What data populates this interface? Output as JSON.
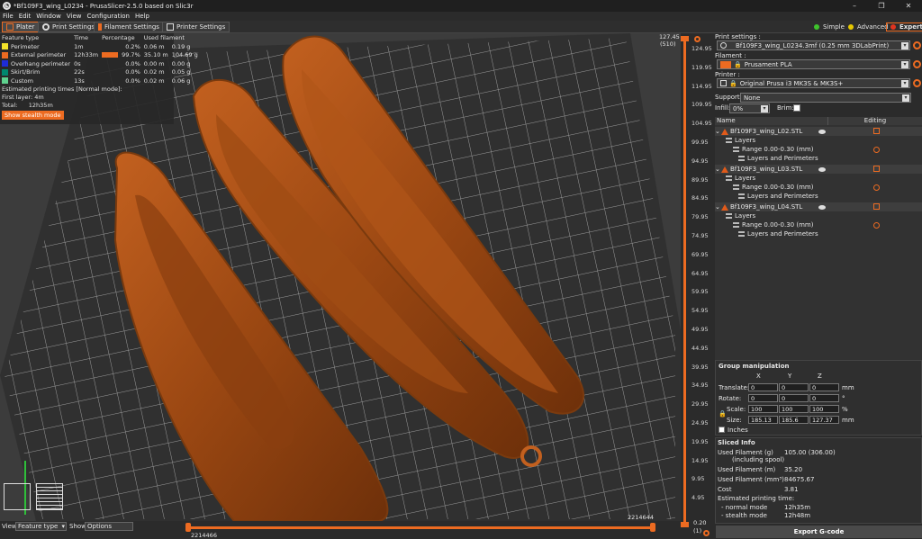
{
  "window": {
    "title": "*Bf109F3_wing_L0234 - PrusaSlicer-2.5.0 based on Slic3r",
    "controls": [
      "–",
      "❐",
      "✕"
    ]
  },
  "menu": [
    "File",
    "Edit",
    "Window",
    "View",
    "Configuration",
    "Help"
  ],
  "tabs": [
    "Plater",
    "Print Settings",
    "Filament Settings",
    "Printer Settings"
  ],
  "modes": [
    {
      "label": "Simple",
      "color": "#3ec32c"
    },
    {
      "label": "Advanced",
      "color": "#e6c800"
    },
    {
      "label": "Expert",
      "color": "#e0341f"
    }
  ],
  "legend": {
    "headers": [
      "Feature type",
      "Time",
      "Percentage",
      "Used filament"
    ],
    "rows": [
      {
        "name": "Perimeter",
        "color": "#f2e22a",
        "time": "1m",
        "pct": "0.2%",
        "pct_value": 0.2,
        "len": "0.06 m",
        "weight": "0.19 g"
      },
      {
        "name": "External perimeter",
        "color": "#ed6b21",
        "time": "12h33m",
        "pct": "99.7%",
        "pct_value": 99.7,
        "len": "35.10 m",
        "weight": "104.69 g"
      },
      {
        "name": "Overhang perimeter",
        "color": "#1e2cd7",
        "time": "0s",
        "pct": "0.0%",
        "pct_value": 0.0,
        "len": "0.00 m",
        "weight": "0.00 g"
      },
      {
        "name": "Skirt/Brim",
        "color": "#00876e",
        "time": "22s",
        "pct": "0.0%",
        "pct_value": 0.0,
        "len": "0.02 m",
        "weight": "0.05 g"
      },
      {
        "name": "Custom",
        "color": "#5ed18e",
        "time": "13s",
        "pct": "0.0%",
        "pct_value": 0.0,
        "len": "0.02 m",
        "weight": "0.06 g"
      }
    ],
    "est_title": "Estimated printing times [Normal mode]:",
    "first_layer": "First layer: 4m",
    "total_label": "Total:",
    "total_value": "12h35m",
    "stealth_button": "Show stealth mode"
  },
  "bottom": {
    "view_label": "View",
    "view_value": "Feature type",
    "show_label": "Show",
    "show_value": "Options",
    "h_slider_left": "2214466",
    "h_slider_right": "2214644"
  },
  "vertical_slider": {
    "top_value": "127.45",
    "top_layer": "(510)",
    "bottom_value": "0.20",
    "bottom_layer": "(1)",
    "ticks": [
      "124.95",
      "119.95",
      "114.95",
      "109.95",
      "104.95",
      "99.95",
      "94.95",
      "89.95",
      "84.95",
      "79.95",
      "74.95",
      "69.95",
      "64.95",
      "59.95",
      "54.95",
      "49.95",
      "44.95",
      "39.95",
      "34.95",
      "29.95",
      "24.95",
      "19.95",
      "14.95",
      "9.95",
      "4.95"
    ]
  },
  "settings": {
    "print_label": "Print settings :",
    "print_value": "Bf109F3_wing_L0234.3mf (0.25 mm 3DLabPrint)",
    "filament_label": "Filament :",
    "filament_value": "Prusament PLA",
    "filament_color": "#ed6b21",
    "printer_label": "Printer :",
    "printer_value": "Original Prusa i3 MK3S & MK3S+",
    "supports_label": "Supports:",
    "supports_value": "None",
    "infill_label": "Infill:",
    "infill_value": "0%",
    "brim_label": "Brim:"
  },
  "objects": {
    "headers": [
      "Name",
      "Editing"
    ],
    "items": [
      {
        "name": "Bf109F3_wing_L02.STL",
        "layers": "Layers",
        "range": "Range 0.00-0.30 (mm)",
        "lp": "Layers and Perimeters"
      },
      {
        "name": "Bf109F3_wing_L03.STL",
        "layers": "Layers",
        "range": "Range 0.00-0.30 (mm)",
        "lp": "Layers and Perimeters"
      },
      {
        "name": "Bf109F3_wing_L04.STL",
        "layers": "Layers",
        "range": "Range 0.00-0.30 (mm)",
        "lp": "Layers and Perimeters"
      }
    ]
  },
  "group": {
    "title": "Group manipulation",
    "axes": [
      "X",
      "Y",
      "Z"
    ],
    "translate_label": "Translate:",
    "translate": [
      "0",
      "0",
      "0"
    ],
    "translate_unit": "mm",
    "rotate_label": "Rotate:",
    "rotate": [
      "0",
      "0",
      "0"
    ],
    "rotate_unit": "°",
    "scale_label": "Scale:",
    "scale": [
      "100",
      "100",
      "100"
    ],
    "scale_unit": "%",
    "size_label": "Size:",
    "size": [
      "185.13",
      "185.6",
      "127.37"
    ],
    "size_unit": "mm",
    "inches_label": "Inches"
  },
  "sliced": {
    "title": "Sliced Info",
    "used_g_label": "Used Filament (g)",
    "used_g_sub": "(including spool)",
    "used_g_value": "105.00 (306.00)",
    "used_m_label": "Used Filament (m)",
    "used_m_value": "35.20",
    "used_mm3_label": "Used Filament (mm³)",
    "used_mm3_value": "84675.67",
    "cost_label": "Cost",
    "cost_value": "3.81",
    "est_label": "Estimated printing time:",
    "normal_label": "- normal mode",
    "normal_value": "12h35m",
    "stealth_label": "- stealth mode",
    "stealth_value": "12h48m"
  },
  "export_button": "Export G-code"
}
